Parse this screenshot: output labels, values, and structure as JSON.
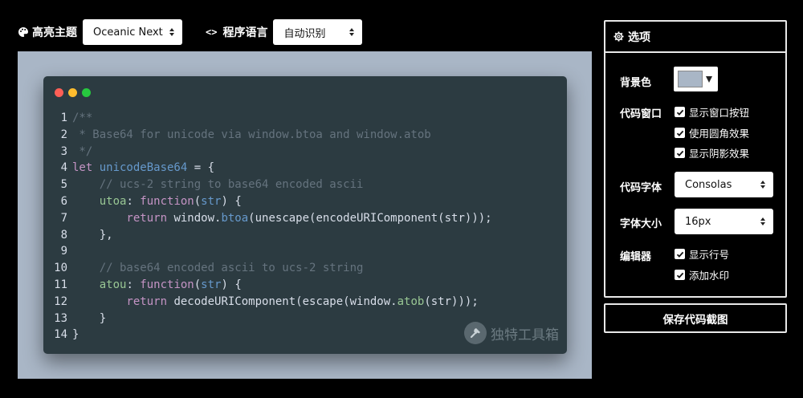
{
  "toolbar": {
    "theme_label": "高亮主题",
    "theme_value": "Oceanic Next",
    "lang_label": "程序语言",
    "lang_value": "自动识别"
  },
  "window": {
    "dot_colors": [
      "#ff5f56",
      "#ffbd2e",
      "#27c93f"
    ],
    "watermark": "独特工具箱"
  },
  "code": {
    "lines": [
      [
        [
          "c-com",
          "/**"
        ]
      ],
      [
        [
          "c-com",
          " * Base64 for unicode via window.btoa and window.atob"
        ]
      ],
      [
        [
          "c-com",
          " */"
        ]
      ],
      [
        [
          "c-kw",
          "let "
        ],
        [
          "c-var",
          "unicodeBase64"
        ],
        [
          "c-txt",
          " = {"
        ]
      ],
      [
        [
          "c-com",
          "    // ucs-2 string to base64 encoded ascii"
        ]
      ],
      [
        [
          "c-prop",
          "    utoa"
        ],
        [
          "c-txt",
          ": "
        ],
        [
          "c-kw",
          "function"
        ],
        [
          "c-txt",
          "("
        ],
        [
          "c-var",
          "str"
        ],
        [
          "c-txt",
          ") {"
        ]
      ],
      [
        [
          "c-kw",
          "        return "
        ],
        [
          "c-txt",
          "window."
        ],
        [
          "c-var",
          "btoa"
        ],
        [
          "c-txt",
          "(unescape(encodeURIComponent(str)));"
        ]
      ],
      [
        [
          "c-txt",
          "    },"
        ]
      ],
      [
        [
          "c-txt",
          ""
        ]
      ],
      [
        [
          "c-com",
          "    // base64 encoded ascii to ucs-2 string"
        ]
      ],
      [
        [
          "c-prop",
          "    atou"
        ],
        [
          "c-txt",
          ": "
        ],
        [
          "c-kw",
          "function"
        ],
        [
          "c-txt",
          "("
        ],
        [
          "c-var",
          "str"
        ],
        [
          "c-txt",
          ") {"
        ]
      ],
      [
        [
          "c-kw",
          "        return "
        ],
        [
          "c-txt",
          "decodeURIComponent(escape(window."
        ],
        [
          "c-prop",
          "atob"
        ],
        [
          "c-txt",
          "(str)));"
        ]
      ],
      [
        [
          "c-txt",
          "    }"
        ]
      ],
      [
        [
          "c-txt",
          "}"
        ]
      ]
    ]
  },
  "panel": {
    "title": "选项",
    "bg_label": "背景色",
    "bg_color": "#a9b6c6",
    "window_label": "代码窗口",
    "opt_window_buttons": "显示窗口按钮",
    "opt_rounded": "使用圆角效果",
    "opt_shadow": "显示阴影效果",
    "font_label": "代码字体",
    "font_value": "Consolas",
    "size_label": "字体大小",
    "size_value": "16px",
    "editor_label": "编辑器",
    "opt_line_numbers": "显示行号",
    "opt_watermark": "添加水印"
  },
  "save_button": "保存代码截图",
  "colors": {
    "page_bg": "#000000",
    "canvas_bg": "#a9b6c6",
    "code_bg": "#2c3b41",
    "keyword": "#c594c5",
    "variable": "#6699cc",
    "property": "#99c794",
    "comment": "#65737e"
  }
}
